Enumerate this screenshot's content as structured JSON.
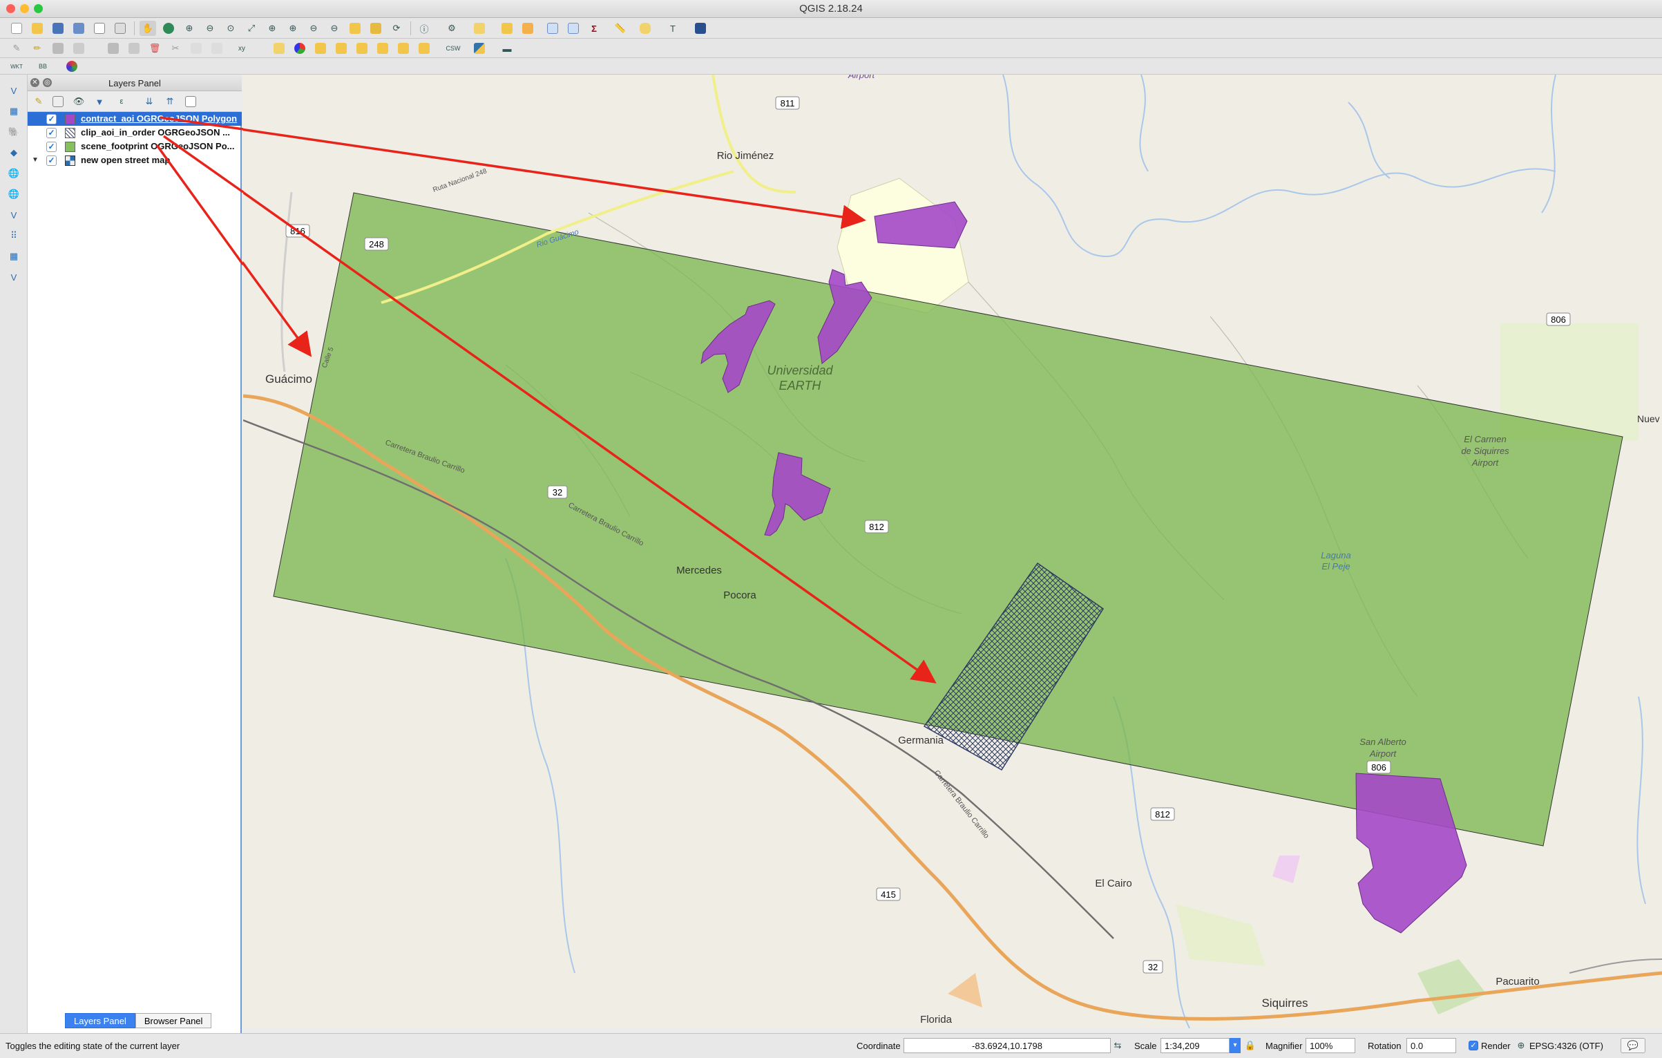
{
  "window": {
    "title": "QGIS 2.18.24"
  },
  "layers_panel": {
    "title": "Layers Panel",
    "layers": [
      {
        "name": "contract_aoi OGRGeoJSON Polygon",
        "checked": true,
        "selected": true,
        "swatch": "#a448c8"
      },
      {
        "name": "clip_aoi_in_order OGRGeoJSON ...",
        "checked": true,
        "selected": false,
        "swatch": "hatched"
      },
      {
        "name": "scene_footprint OGRGeoJSON Po...",
        "checked": true,
        "selected": false,
        "swatch": "#86bf5d"
      },
      {
        "name": "new open street map",
        "checked": true,
        "selected": false,
        "swatch": "osm"
      }
    ],
    "tabs": [
      "Layers Panel",
      "Browser Panel"
    ],
    "active_tab": "Layers Panel"
  },
  "map": {
    "labels": {
      "rio_jimenez": "Rio Jiménez",
      "guacimo": "Guácimo",
      "universidad": "Universidad",
      "earth": "EARTH",
      "mercedes": "Mercedes",
      "pocora": "Pocora",
      "germania": "Germania",
      "el_cairo": "El Cairo",
      "siquirres": "Siquirres",
      "florida": "Florida",
      "pacuarito": "Pacuarito",
      "airport_top": "Airport",
      "el_carmen_1": "El Carmen",
      "el_carmen_2": "de Siquirres",
      "el_carmen_3": "Airport",
      "san_alberto_1": "San Alberto",
      "san_alberto_2": "Airport",
      "laguna_1": "Laguna",
      "laguna_2": "El Peje",
      "nueva": "Nuev",
      "carretera_1": "Carretera Braulio Carrillo",
      "carretera_2": "Carretera Braulio Carrillo",
      "carretera_3": "Carretera Braulio Carrillo",
      "ruta_248": "Ruta Nacional 248",
      "calle": "Calle 5",
      "rio_guacimo": "Rio Guácimo"
    },
    "road_shields": [
      "811",
      "816",
      "248",
      "32",
      "812",
      "806",
      "806",
      "812",
      "415",
      "32"
    ]
  },
  "status_bar": {
    "message": "Toggles the editing state of the current layer",
    "coordinate_label": "Coordinate",
    "coordinate": "-83.6924,10.1798",
    "scale_label": "Scale",
    "scale": "1:34,209",
    "magnifier_label": "Magnifier",
    "magnifier": "100%",
    "rotation_label": "Rotation",
    "rotation": "0.0",
    "render_label": "Render",
    "render_checked": true,
    "crs": "EPSG:4326 (OTF)"
  },
  "colors": {
    "footprint": "#86bf5d",
    "aoi": "#a448c8",
    "arrow": "#e8241a",
    "selection": "#2b6fd6"
  }
}
